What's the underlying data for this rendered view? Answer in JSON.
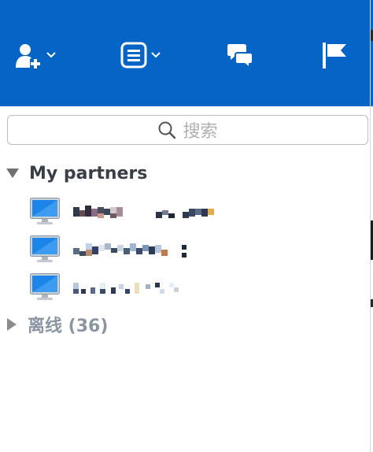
{
  "colors": {
    "brand_blue": "#0565c6",
    "toolbar_icon": "#ffffff"
  },
  "toolbar": {
    "items": [
      {
        "icon": "add-user-icon",
        "has_dropdown": true
      },
      {
        "icon": "list-icon",
        "has_dropdown": true
      },
      {
        "icon": "chat-icon",
        "has_dropdown": false
      },
      {
        "icon": "flag-icon",
        "has_dropdown": false
      }
    ]
  },
  "search": {
    "placeholder": "搜索",
    "icon": "search-icon"
  },
  "groups": {
    "my_partners": {
      "label": "My partners",
      "expanded": true
    },
    "offline": {
      "label": "离线 (36)",
      "expanded": false
    }
  },
  "partners": [
    {
      "icon": "computer-monitor-icon",
      "name": ""
    },
    {
      "icon": "computer-monitor-icon",
      "name": ""
    },
    {
      "icon": "computer-monitor-icon",
      "name": ""
    }
  ]
}
